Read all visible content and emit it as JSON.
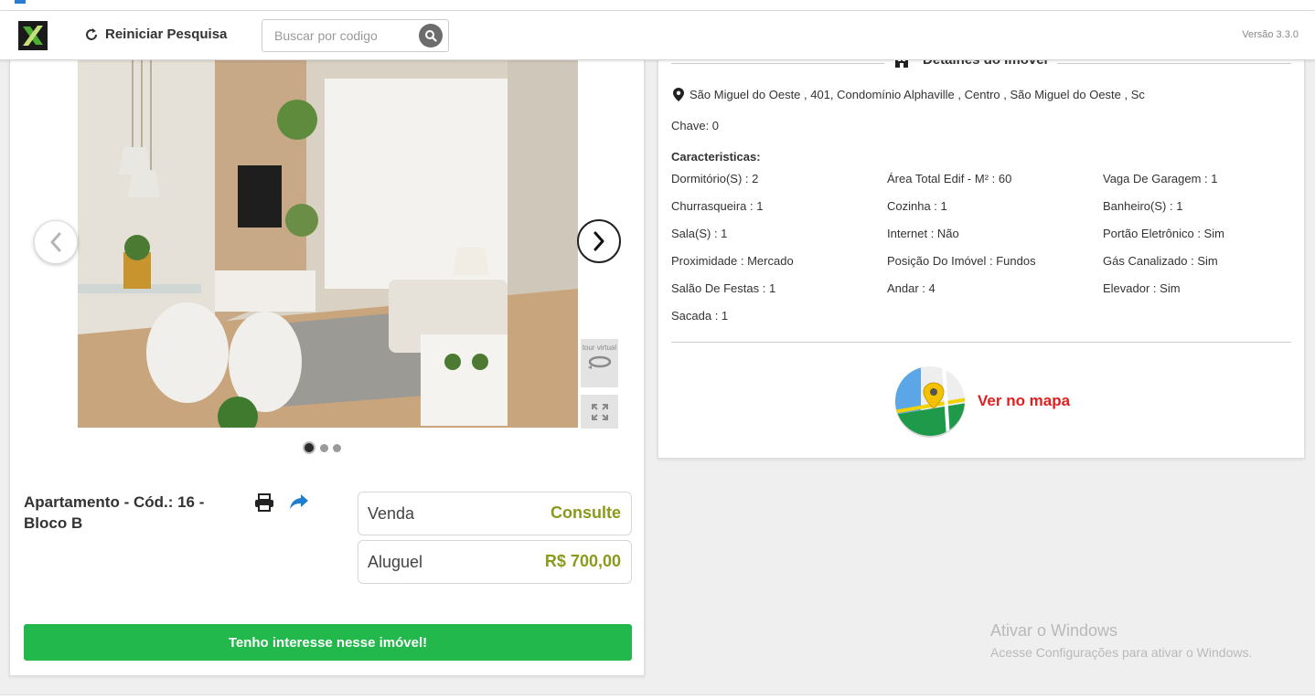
{
  "header": {
    "reset_label": "Reiniciar Pesquisa",
    "search_placeholder": "Buscar por codigo",
    "version": "Versão 3.3.0"
  },
  "gallery": {
    "tour_label": "tour virtual",
    "slide_count": 3,
    "active_slide": 1
  },
  "property": {
    "title": "Apartamento - Cód.: 16 - Bloco B",
    "prices": [
      {
        "label": "Venda",
        "value": "Consulte"
      },
      {
        "label": "Aluguel",
        "value": "R$ 700,00"
      }
    ],
    "interest_button": "Tenho interesse nesse imóvel!"
  },
  "details": {
    "heading": "Detalhes do Imóvel",
    "address": "São Miguel do Oeste , 401, Condomínio Alphaville , Centro , São Miguel do Oeste , Sc",
    "key": "Chave: 0",
    "features_heading": "Caracteristicas:",
    "features": [
      "Dormitório(S) : 2",
      "Área Total Edif - M² : 60",
      "Vaga De Garagem : 1",
      "Churrasqueira : 1",
      "Cozinha : 1",
      "Banheiro(S) : 1",
      "Sala(S) : 1",
      "Internet : Não",
      "Portão Eletrônico : Sim",
      "Proximidade : Mercado",
      "Posição Do Imóvel : Fundos",
      "Gás Canalizado : Sim",
      "Salão De Festas : 1",
      "Andar : 4",
      "Elevador : Sim",
      "Sacada : 1"
    ],
    "map_label": "Ver no mapa"
  },
  "watermark": {
    "line1": "Ativar o Windows",
    "line2": "Acesse Configurações para ativar o Windows."
  },
  "colors": {
    "price": "#8b9a1a",
    "interest_button": "#22b84b",
    "map_link": "#e02020"
  }
}
